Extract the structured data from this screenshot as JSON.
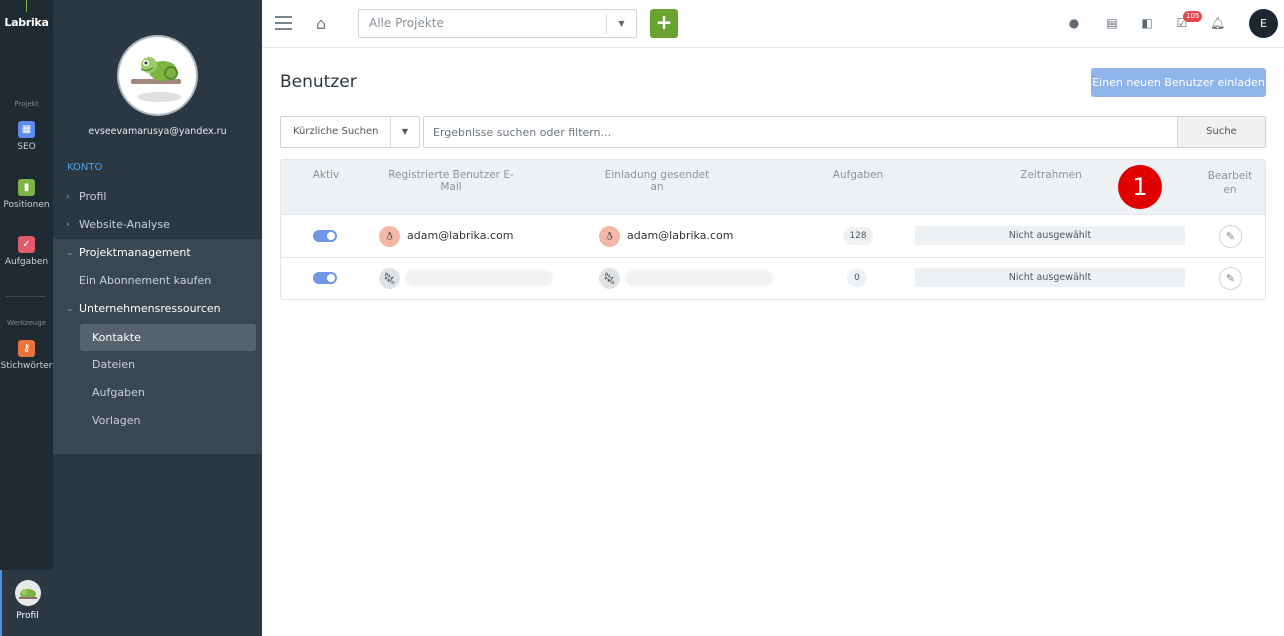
{
  "rail": {
    "logo": "Labrika",
    "section_projekt": "Projekt",
    "section_werkzeuge": "Werkzeuge",
    "items": [
      {
        "label": "SEO",
        "color": "#5b8def",
        "icon": "seo-icon"
      },
      {
        "label": "Positionen",
        "color": "#7cb342",
        "icon": "chart-icon"
      },
      {
        "label": "Aufgaben",
        "color": "#e05a6a",
        "icon": "checkbox-icon"
      },
      {
        "label": "Stichwörter",
        "color": "#e8743b",
        "icon": "key-icon"
      }
    ],
    "profile_label": "Profil"
  },
  "sidebar": {
    "email": "evseevamarusya@yandex.ru",
    "konto": "KONTO",
    "menu": [
      {
        "label": "Profil"
      },
      {
        "label": "Website-Analyse"
      },
      {
        "label": "Projektmanagement"
      },
      {
        "label": "Ein Abonnement kaufen"
      },
      {
        "label": "Unternehmensressourcen"
      }
    ],
    "sub": [
      "Kontakte",
      "Dateien",
      "Aufgaben",
      "Vorlagen"
    ]
  },
  "topbar": {
    "project_placeholder": "Alle Projekte",
    "add_label": "+",
    "badge": "105",
    "user_initial": "E"
  },
  "main": {
    "title": "Benutzer",
    "invite_label": "Einen neuen Benutzer einladen",
    "recent_label": "Kürzliche Suchen",
    "search_placeholder": "Ergebnisse suchen oder filtern...",
    "search_button": "Suche"
  },
  "table": {
    "headers": [
      "Aktiv",
      "Registrierte Benutzer E-Mail",
      "Einladung gesendet an",
      "Aufgaben",
      "Zeitrahmen",
      "Bearbeiten"
    ],
    "rows": [
      {
        "registered": "adam@labrika.com",
        "invited": "adam@labrika.com",
        "tasks": "128",
        "timeframe": "Nicht ausgewählt"
      },
      {
        "registered": "",
        "invited": "",
        "tasks": "0",
        "timeframe": "Nicht ausgewählt"
      }
    ]
  },
  "annotation": {
    "marker": "1"
  }
}
